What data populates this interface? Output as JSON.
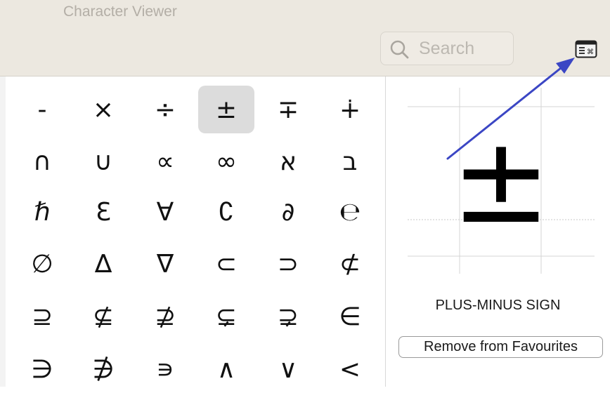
{
  "window": {
    "title": "Character Viewer"
  },
  "search": {
    "placeholder": "Search"
  },
  "toolbar": {
    "keyboard_icon": "keyboard-viewer-icon"
  },
  "characters": [
    [
      "-",
      "×",
      "÷",
      "±",
      "∓",
      "∔"
    ],
    [
      "∩",
      "∪",
      "∝",
      "∞",
      "א",
      "ב"
    ],
    [
      "ℏ",
      "Ɛ",
      "∀",
      "∁",
      "∂",
      "℮"
    ],
    [
      "∅",
      "∆",
      "∇",
      "⊂",
      "⊃",
      "⊄"
    ],
    [
      "⊇",
      "⊈",
      "⊉",
      "⊊",
      "⊋",
      "∈"
    ],
    [
      "∋",
      "∌",
      "∍",
      "∧",
      "∨",
      "<"
    ]
  ],
  "selected": {
    "char": "±",
    "name": "PLUS-MINUS SIGN"
  },
  "actions": {
    "remove_label": "Remove from Favourites"
  },
  "annotation": {
    "arrow_color": "#3b46c4"
  }
}
